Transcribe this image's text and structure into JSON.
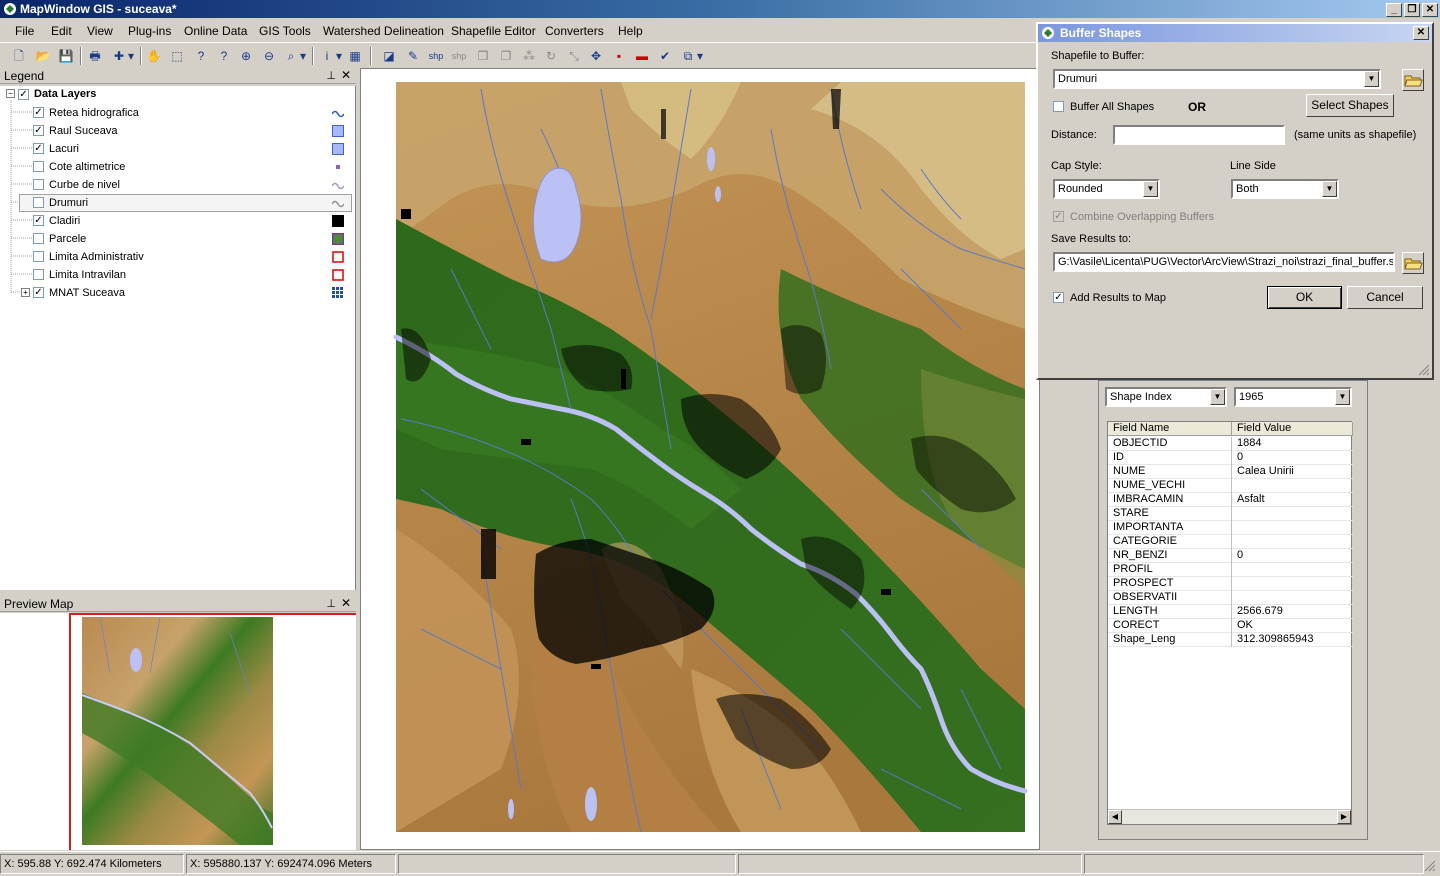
{
  "window": {
    "title": "MapWindow GIS  - suceava*"
  },
  "menu": [
    "File",
    "Edit",
    "View",
    "Plug-ins",
    "Online Data",
    "GIS Tools",
    "Watershed Delineation",
    "Shapefile Editor",
    "Converters",
    "Help"
  ],
  "toolbar": {
    "shp_label_1": "shp",
    "shp_label_2": "shp"
  },
  "legend": {
    "title": "Legend",
    "group": "Data Layers",
    "layers": [
      {
        "name": "Retea hidrografica",
        "checked": "✓",
        "symbol": "wave"
      },
      {
        "name": "Raul Suceava",
        "checked": "✓",
        "symbol": "fill-blue"
      },
      {
        "name": "Lacuri",
        "checked": "✓",
        "symbol": "fill-blue"
      },
      {
        "name": "Cote altimetrice",
        "checked": "",
        "symbol": "point-purple"
      },
      {
        "name": "Curbe de nivel",
        "checked": "",
        "symbol": "wave-purple"
      },
      {
        "name": "Drumuri",
        "checked": "",
        "symbol": "wave-gray"
      },
      {
        "name": "Cladiri",
        "checked": "✓",
        "symbol": "fill-black"
      },
      {
        "name": "Parcele",
        "checked": "",
        "symbol": "fill-green"
      },
      {
        "name": "Limita Administrativ",
        "checked": "",
        "symbol": "outline-red"
      },
      {
        "name": "Limita Intravilan",
        "checked": "",
        "symbol": "outline-red"
      },
      {
        "name": "MNAT Suceava",
        "checked": "✓",
        "symbol": "grid-blue"
      }
    ]
  },
  "preview": {
    "title": "Preview Map"
  },
  "buffer_dialog": {
    "title": "Buffer Shapes",
    "shapefile_label": "Shapefile to Buffer:",
    "shapefile_value": "Drumuri",
    "buffer_all_label": "Buffer All Shapes",
    "or_label": "OR",
    "select_shapes_label": "Select Shapes",
    "distance_label": "Distance:",
    "distance_value": "",
    "distance_units": "(same units as shapefile)",
    "cap_style_label": "Cap Style:",
    "cap_style_value": "Rounded",
    "line_side_label": "Line Side",
    "line_side_value": "Both",
    "combine_label": "Combine Overlapping Buffers",
    "save_label": "Save Results to:",
    "save_value": "G:\\Vasile\\Licenta\\PUG\\Vector\\ArcView\\Strazi_noi\\strazi_final_buffer.s",
    "add_results_label": "Add Results to Map",
    "ok_label": "OK",
    "cancel_label": "Cancel"
  },
  "attributes": {
    "index_label": "Shape Index",
    "index_value": "1965",
    "header_name": "Field Name",
    "header_value": "Field Value",
    "rows": [
      {
        "name": "OBJECTID",
        "value": "1884"
      },
      {
        "name": "ID",
        "value": "0"
      },
      {
        "name": "NUME",
        "value": "Calea Unirii"
      },
      {
        "name": "NUME_VECHI",
        "value": ""
      },
      {
        "name": "IMBRACAMIN",
        "value": "Asfalt"
      },
      {
        "name": "STARE",
        "value": ""
      },
      {
        "name": "IMPORTANTA",
        "value": ""
      },
      {
        "name": "CATEGORIE",
        "value": ""
      },
      {
        "name": "NR_BENZI",
        "value": "0"
      },
      {
        "name": "PROFIL",
        "value": ""
      },
      {
        "name": "PROSPECT",
        "value": ""
      },
      {
        "name": "OBSERVATII",
        "value": ""
      },
      {
        "name": "LENGTH",
        "value": "2566.679"
      },
      {
        "name": "CORECT",
        "value": "OK"
      },
      {
        "name": "Shape_Leng",
        "value": "312.309865943"
      }
    ]
  },
  "status": {
    "km": "X: 595.88    Y: 692.474 Kilometers",
    "m": "X: 595880.137    Y: 692474.096 Meters"
  },
  "colors": {
    "water": "#bcc1f5",
    "river_lines": "#5a78c8",
    "lowland": "#2f6e1c",
    "highland": "#c99a5a"
  }
}
